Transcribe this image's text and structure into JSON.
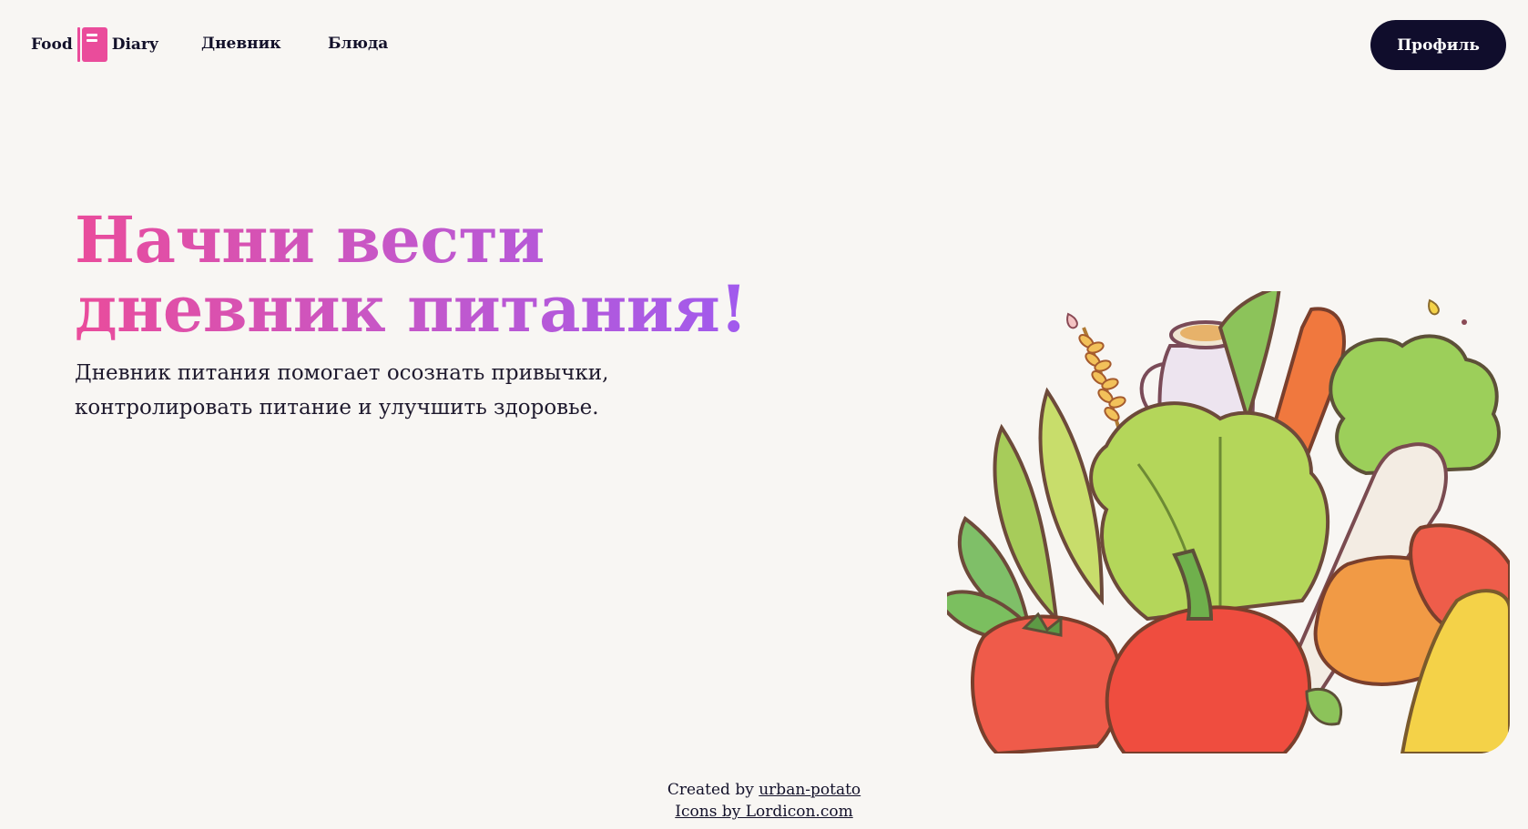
{
  "header": {
    "brand_left": "Food",
    "brand_right": "Diary",
    "nav": [
      "Дневник",
      "Блюда"
    ],
    "profile_button": "Профиль"
  },
  "hero": {
    "title_line1": "Начни вести",
    "title_line2": "дневник питания!",
    "subtitle_line1": "Дневник питания помогает осознать привычки,",
    "subtitle_line2": "контролировать питание и улучшить здоровье."
  },
  "footer": {
    "created_prefix": "Created by ",
    "created_link": "urban-potato",
    "icons_link": "Icons by Lordicon.com"
  },
  "icons": {
    "logo": "notebook-icon"
  },
  "colors": {
    "background": "#f8f6f3",
    "accent_pink": "#ea4c9b",
    "accent_purple": "#9c5bf2",
    "button_dark": "#100d2c",
    "text": "#13112a"
  }
}
